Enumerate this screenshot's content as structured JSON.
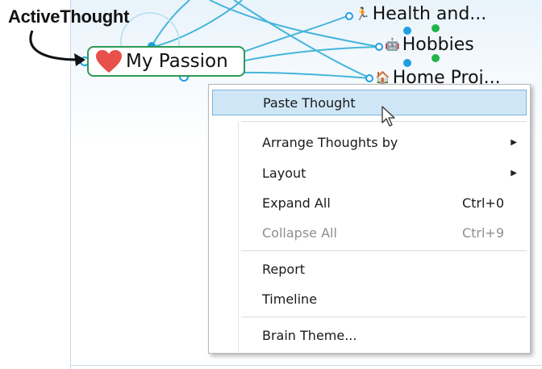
{
  "annotation": {
    "label": "ActiveThought"
  },
  "active_thought": {
    "name": "My Passion",
    "icon": "heart-icon"
  },
  "child_thoughts": [
    {
      "name": "Health and...",
      "icon": "person-running-icon"
    },
    {
      "name": "Hobbies",
      "icon": "robot-icon"
    },
    {
      "name": "Home Proj...",
      "icon": "house-icon"
    }
  ],
  "context_menu": {
    "items": [
      {
        "label": "Paste Thought",
        "shortcut": "",
        "submenu": false,
        "disabled": false,
        "highlighted": true
      },
      {
        "label": "Arrange Thoughts by",
        "shortcut": "",
        "submenu": true,
        "disabled": false,
        "highlighted": false
      },
      {
        "label": "Layout",
        "shortcut": "",
        "submenu": true,
        "disabled": false,
        "highlighted": false
      },
      {
        "label": "Expand All",
        "shortcut": "Ctrl+0",
        "submenu": false,
        "disabled": false,
        "highlighted": false
      },
      {
        "label": "Collapse All",
        "shortcut": "Ctrl+9",
        "submenu": false,
        "disabled": true,
        "highlighted": false
      },
      {
        "label": "Report",
        "shortcut": "",
        "submenu": false,
        "disabled": false,
        "highlighted": false
      },
      {
        "label": "Timeline",
        "shortcut": "",
        "submenu": false,
        "disabled": false,
        "highlighted": false
      },
      {
        "label": "Brain Theme...",
        "shortcut": "",
        "submenu": false,
        "disabled": false,
        "highlighted": false
      }
    ]
  },
  "colors": {
    "active_border": "#2e9a55",
    "link_line": "#3ab0d6",
    "menu_highlight": "#cfe6f6",
    "heart": "#e8504a"
  }
}
